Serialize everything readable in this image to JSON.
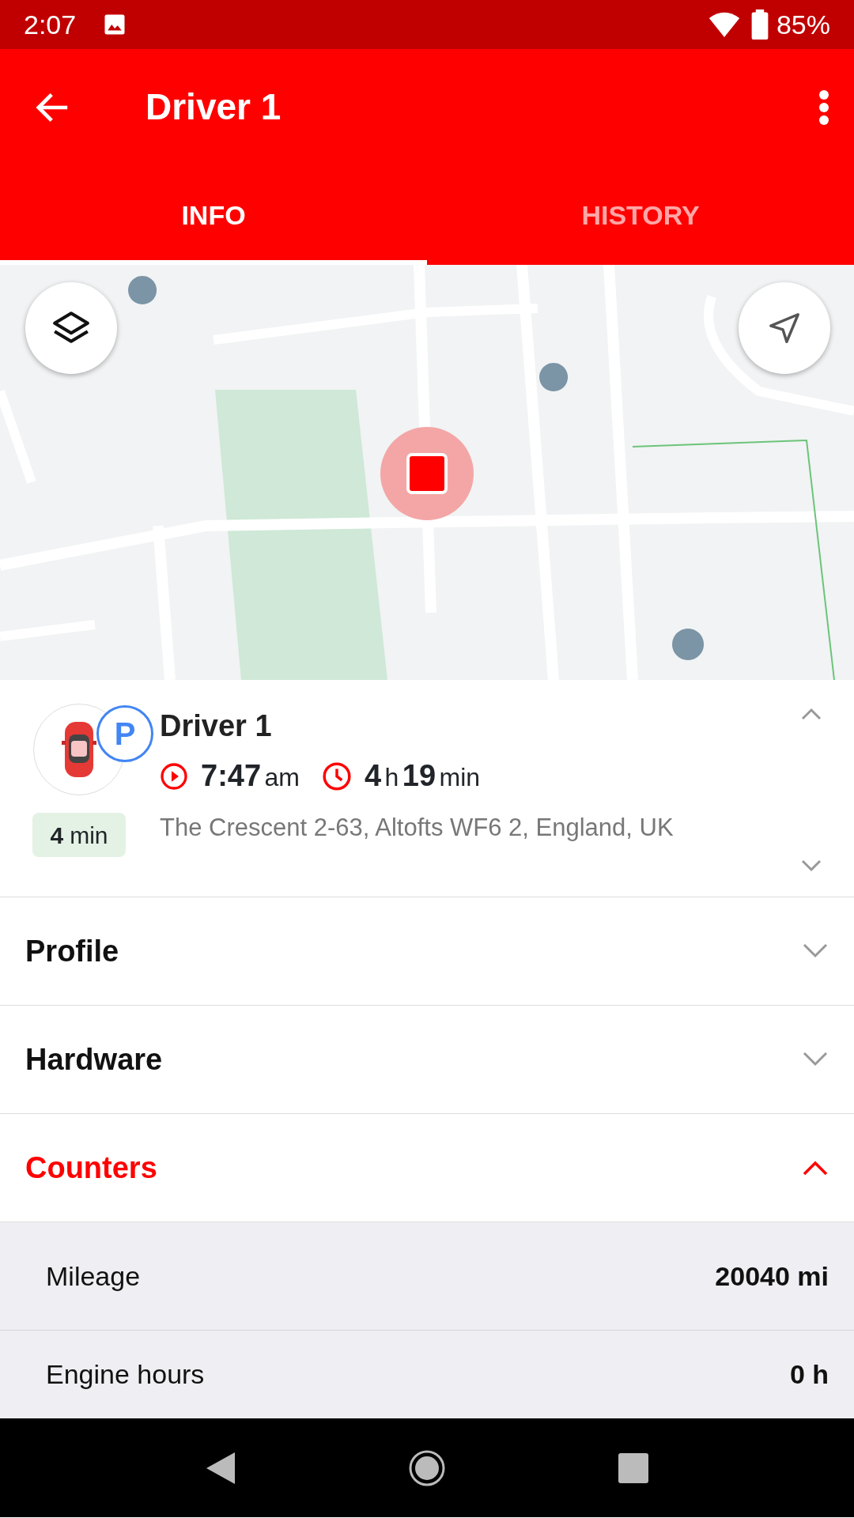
{
  "status_bar": {
    "time": "2:07",
    "battery": "85%"
  },
  "app_bar": {
    "title": "Driver 1"
  },
  "tabs": [
    {
      "label": "INFO",
      "selected": true
    },
    {
      "label": "HISTORY",
      "selected": false
    }
  ],
  "driver": {
    "status_badge": "P",
    "name": "Driver 1",
    "parked_for": {
      "value": "4",
      "unit": "min"
    },
    "start": {
      "value": "7:47",
      "unit": "am"
    },
    "duration": [
      {
        "value": "4",
        "unit": "h"
      },
      {
        "value": "19",
        "unit": "min"
      }
    ],
    "address": "The Crescent 2-63, Altofts WF6 2, England, UK"
  },
  "sections": [
    {
      "title": "Profile",
      "expanded": false
    },
    {
      "title": "Hardware",
      "expanded": false
    },
    {
      "title": "Counters",
      "expanded": true,
      "rows": [
        {
          "label": "Mileage",
          "value": "20040 mi"
        },
        {
          "label": "Engine hours",
          "value": "0 h"
        }
      ]
    }
  ]
}
